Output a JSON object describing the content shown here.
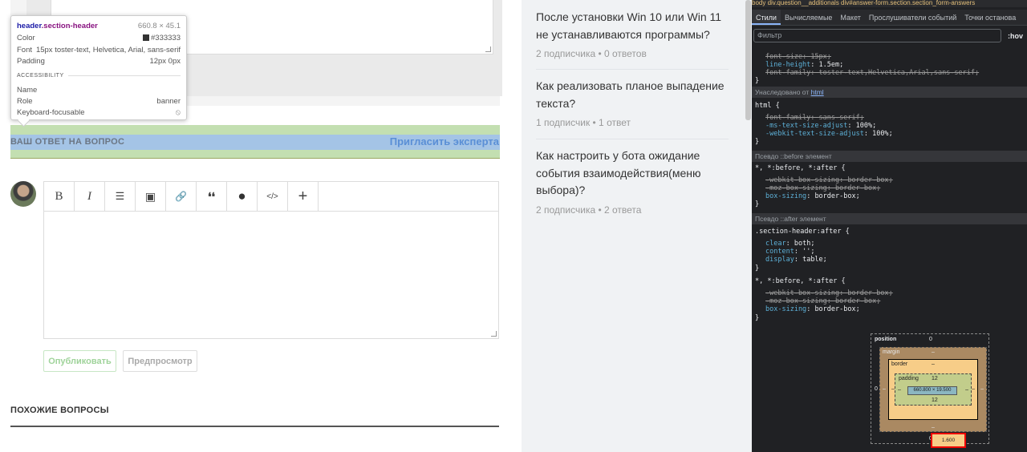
{
  "tooltip": {
    "selector_tag": "header",
    "selector_class": ".section-header",
    "size": "660.8 × 45.1",
    "rows": [
      {
        "label": "Color",
        "value": "#333333"
      },
      {
        "label": "Font",
        "value": "15px toster-text, Helvetica, Arial, sans-serif"
      },
      {
        "label": "Padding",
        "value": "12px 0px"
      }
    ],
    "accessibility_title": "ACCESSIBILITY",
    "a11y": [
      {
        "label": "Name",
        "value": ""
      },
      {
        "label": "Role",
        "value": "banner"
      },
      {
        "label": "Keyboard-focusable",
        "value": "⦸"
      }
    ]
  },
  "answer_header": {
    "title": "ВАШ ОТВЕТ НА ВОПРОС",
    "invite_link": "Пригласить эксперта"
  },
  "editor": {
    "toolbar": [
      {
        "icon": "bold-icon",
        "glyph": "B"
      },
      {
        "icon": "italic-icon",
        "glyph": "I"
      },
      {
        "icon": "list-icon",
        "glyph": "☰"
      },
      {
        "icon": "image-icon",
        "glyph": "▣"
      },
      {
        "icon": "link-icon",
        "glyph": "🔗"
      },
      {
        "icon": "quote-icon",
        "glyph": "❛❛"
      },
      {
        "icon": "circle-icon",
        "glyph": "●"
      },
      {
        "icon": "code-icon",
        "glyph": "</>"
      },
      {
        "icon": "plus-icon",
        "glyph": "+"
      }
    ]
  },
  "buttons": {
    "publish": "Опубликовать",
    "preview": "Предпросмотр"
  },
  "similar_title": "ПОХОЖИЕ ВОПРОСЫ",
  "questions": [
    {
      "title": "После установки Win 10 или Win 11 не устанавливаются программы?",
      "meta": "2 подписчика • 0 ответов"
    },
    {
      "title": "Как реализовать планое выпадение текста?",
      "meta": "1 подписчик • 1 ответ"
    },
    {
      "title": "Как настроить у бота ожидание события взаимодействия(меню выбора)?",
      "meta": "2 подписчика • 2 ответа"
    }
  ],
  "devtools": {
    "breadcrumb": "body   div.question__additionals   div#answer-form.section.section_form-answers",
    "tabs": [
      "Стили",
      "Вычисляемые",
      "Макет",
      "Прослушиватели событий",
      "Точки останова"
    ],
    "filter_placeholder": "Фильтр",
    "hov": ":hov",
    "lines_top": [
      {
        "prop": "font-size",
        "val": "15px",
        "struck": true
      },
      {
        "prop": "line-height",
        "val": "1.5em",
        "struck": false
      },
      {
        "prop": "font-family",
        "val": "toster-text,Helvetica,Arial,sans-serif",
        "struck": true
      }
    ],
    "inherited_label": "Унаследовано от",
    "inherited_from": "html",
    "html_rule": "html {",
    "html_lines": [
      {
        "prop": "font-family",
        "val": "sans-serif",
        "struck": true
      },
      {
        "prop": "-ms-text-size-adjust",
        "val": "100%",
        "struck": false
      },
      {
        "prop": "-webkit-text-size-adjust",
        "val": "100%",
        "struck": false
      }
    ],
    "pseudo_before": "Псевдо ::before элемент",
    "pseudo_after": "Псевдо ::after элемент",
    "rule_all": "*, *:before, *:after {",
    "box_lines": [
      {
        "prop": "-webkit-box-sizing",
        "val": "border-box",
        "struck": true
      },
      {
        "prop": "-moz-box-sizing",
        "val": "border-box",
        "struck": true
      },
      {
        "prop": "box-sizing",
        "val": "border-box",
        "struck": false
      }
    ],
    "after_rule": ".section-header:after {",
    "after_lines": [
      {
        "prop": "clear",
        "val": "both"
      },
      {
        "prop": "content",
        "val": "''"
      },
      {
        "prop": "display",
        "val": "table"
      }
    ],
    "close": "}",
    "box_model": {
      "position_label": "position",
      "position_value": "0",
      "margin_label": "margin",
      "margin_value": "–",
      "border_label": "border",
      "border_value": "–",
      "padding_label": "padding",
      "padding_top": "12",
      "padding_bottom": "12",
      "content": "660.800 × 19.500",
      "side_zero": "0",
      "dash": "–",
      "highlighted_value": "1.600"
    }
  }
}
